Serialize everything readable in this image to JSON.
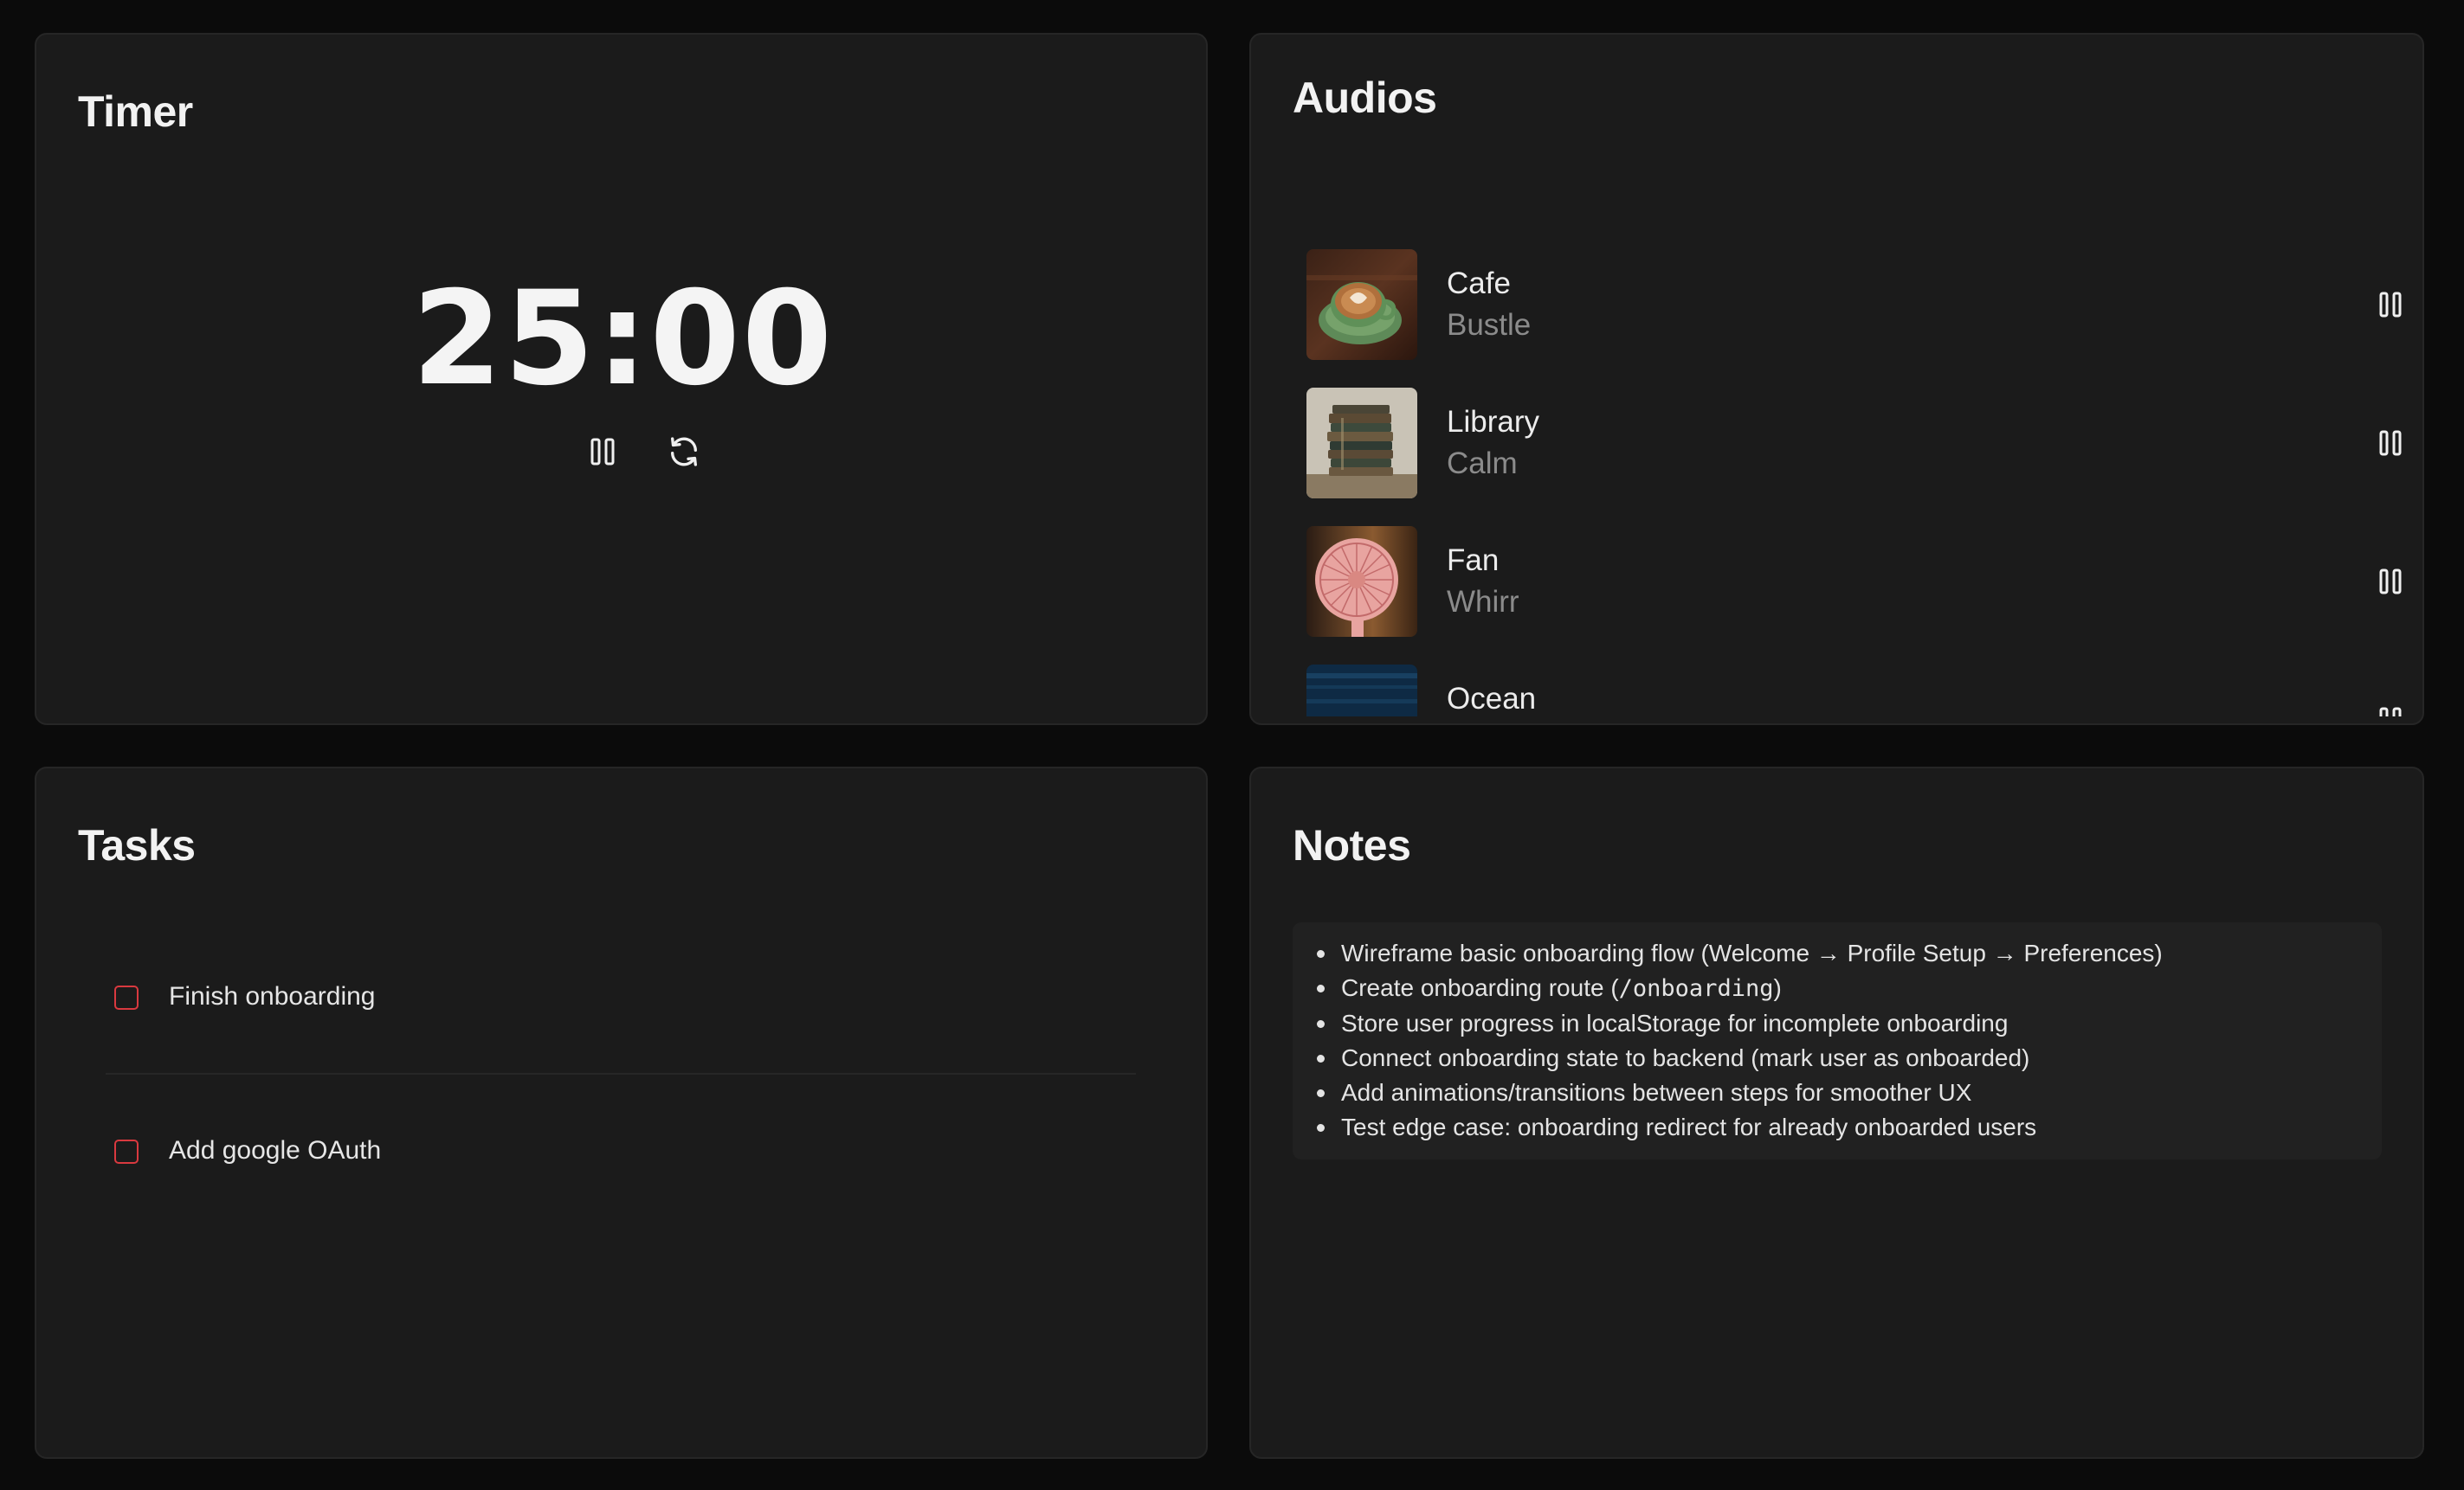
{
  "timer": {
    "title": "Timer",
    "time": "25:00",
    "pause_icon": "pause-icon",
    "reset_icon": "refresh-icon"
  },
  "audios": {
    "title": "Audios",
    "items": [
      {
        "name": "Cafe",
        "subtitle": "Bustle",
        "thumb": "latte-cup",
        "toggle_icon": "pause-icon"
      },
      {
        "name": "Library",
        "subtitle": "Calm",
        "thumb": "book-stack",
        "toggle_icon": "pause-icon"
      },
      {
        "name": "Fan",
        "subtitle": "Whirr",
        "thumb": "pink-fan",
        "toggle_icon": "pause-icon"
      },
      {
        "name": "Ocean",
        "subtitle": "",
        "thumb": "ocean-water",
        "toggle_icon": "pause-icon"
      }
    ]
  },
  "tasks": {
    "title": "Tasks",
    "items": [
      {
        "label": "Finish onboarding",
        "checked": false
      },
      {
        "label": "Add google OAuth",
        "checked": false
      }
    ],
    "checkbox_color": "#d9393f"
  },
  "notes": {
    "title": "Notes",
    "items": [
      {
        "text": "Wireframe basic onboarding flow (Welcome → Profile Setup → Preferences)"
      },
      {
        "prefix": "Create onboarding route (",
        "code": "/onboarding",
        "suffix": ")"
      },
      {
        "text": "Store user progress in localStorage for incomplete onboarding"
      },
      {
        "text": "Connect onboarding state to backend (mark user as onboarded)"
      },
      {
        "text": "Add animations/transitions between steps for smoother UX"
      },
      {
        "text": "Test edge case: onboarding redirect for already onboarded users"
      }
    ]
  },
  "theme": {
    "background": "#0b0b0b",
    "card": "#1b1b1b",
    "accent_red": "#d9393f"
  }
}
